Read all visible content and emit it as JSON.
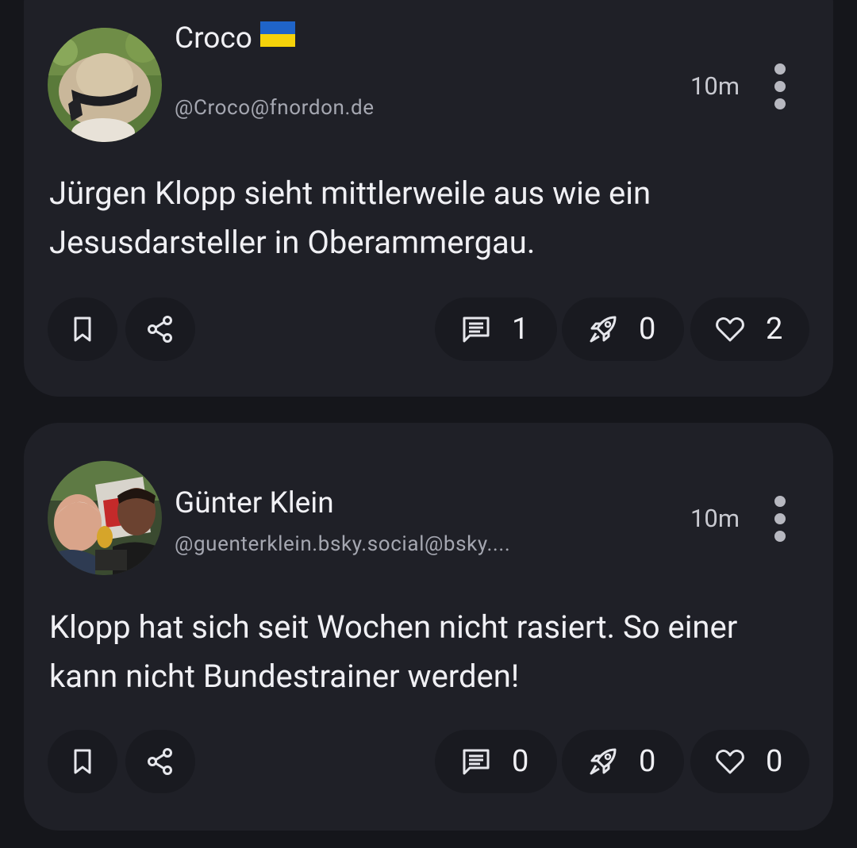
{
  "posts": [
    {
      "author": {
        "display_name": "Croco",
        "flag": "ukraine-flag",
        "handle": "@Croco@fnordon.de"
      },
      "time": "10m",
      "text": "Jürgen Klopp sieht mittlerweile aus wie ein Jesusdarsteller in Oberammergau.",
      "counts": {
        "replies": "1",
        "boosts": "0",
        "favourites": "2"
      }
    },
    {
      "author": {
        "display_name": "Günter Klein",
        "handle": "@guenterklein.bsky.social@bsky...."
      },
      "time": "10m",
      "text": "Klopp hat sich seit Wochen nicht rasiert. So einer kann nicht Bundestrainer werden!",
      "counts": {
        "replies": "0",
        "boosts": "0",
        "favourites": "0"
      }
    }
  ],
  "icons": [
    "bookmark-icon",
    "share-icon",
    "reply-icon",
    "boost-icon",
    "favourite-icon",
    "more-icon"
  ],
  "colors": {
    "background": "#15161b",
    "card": "#1f2027",
    "pill": "#191a20",
    "text": "#f0f0f4",
    "muted": "#a5a7b1",
    "flag_blue": "#1f64c8",
    "flag_yellow": "#f5d20a"
  }
}
